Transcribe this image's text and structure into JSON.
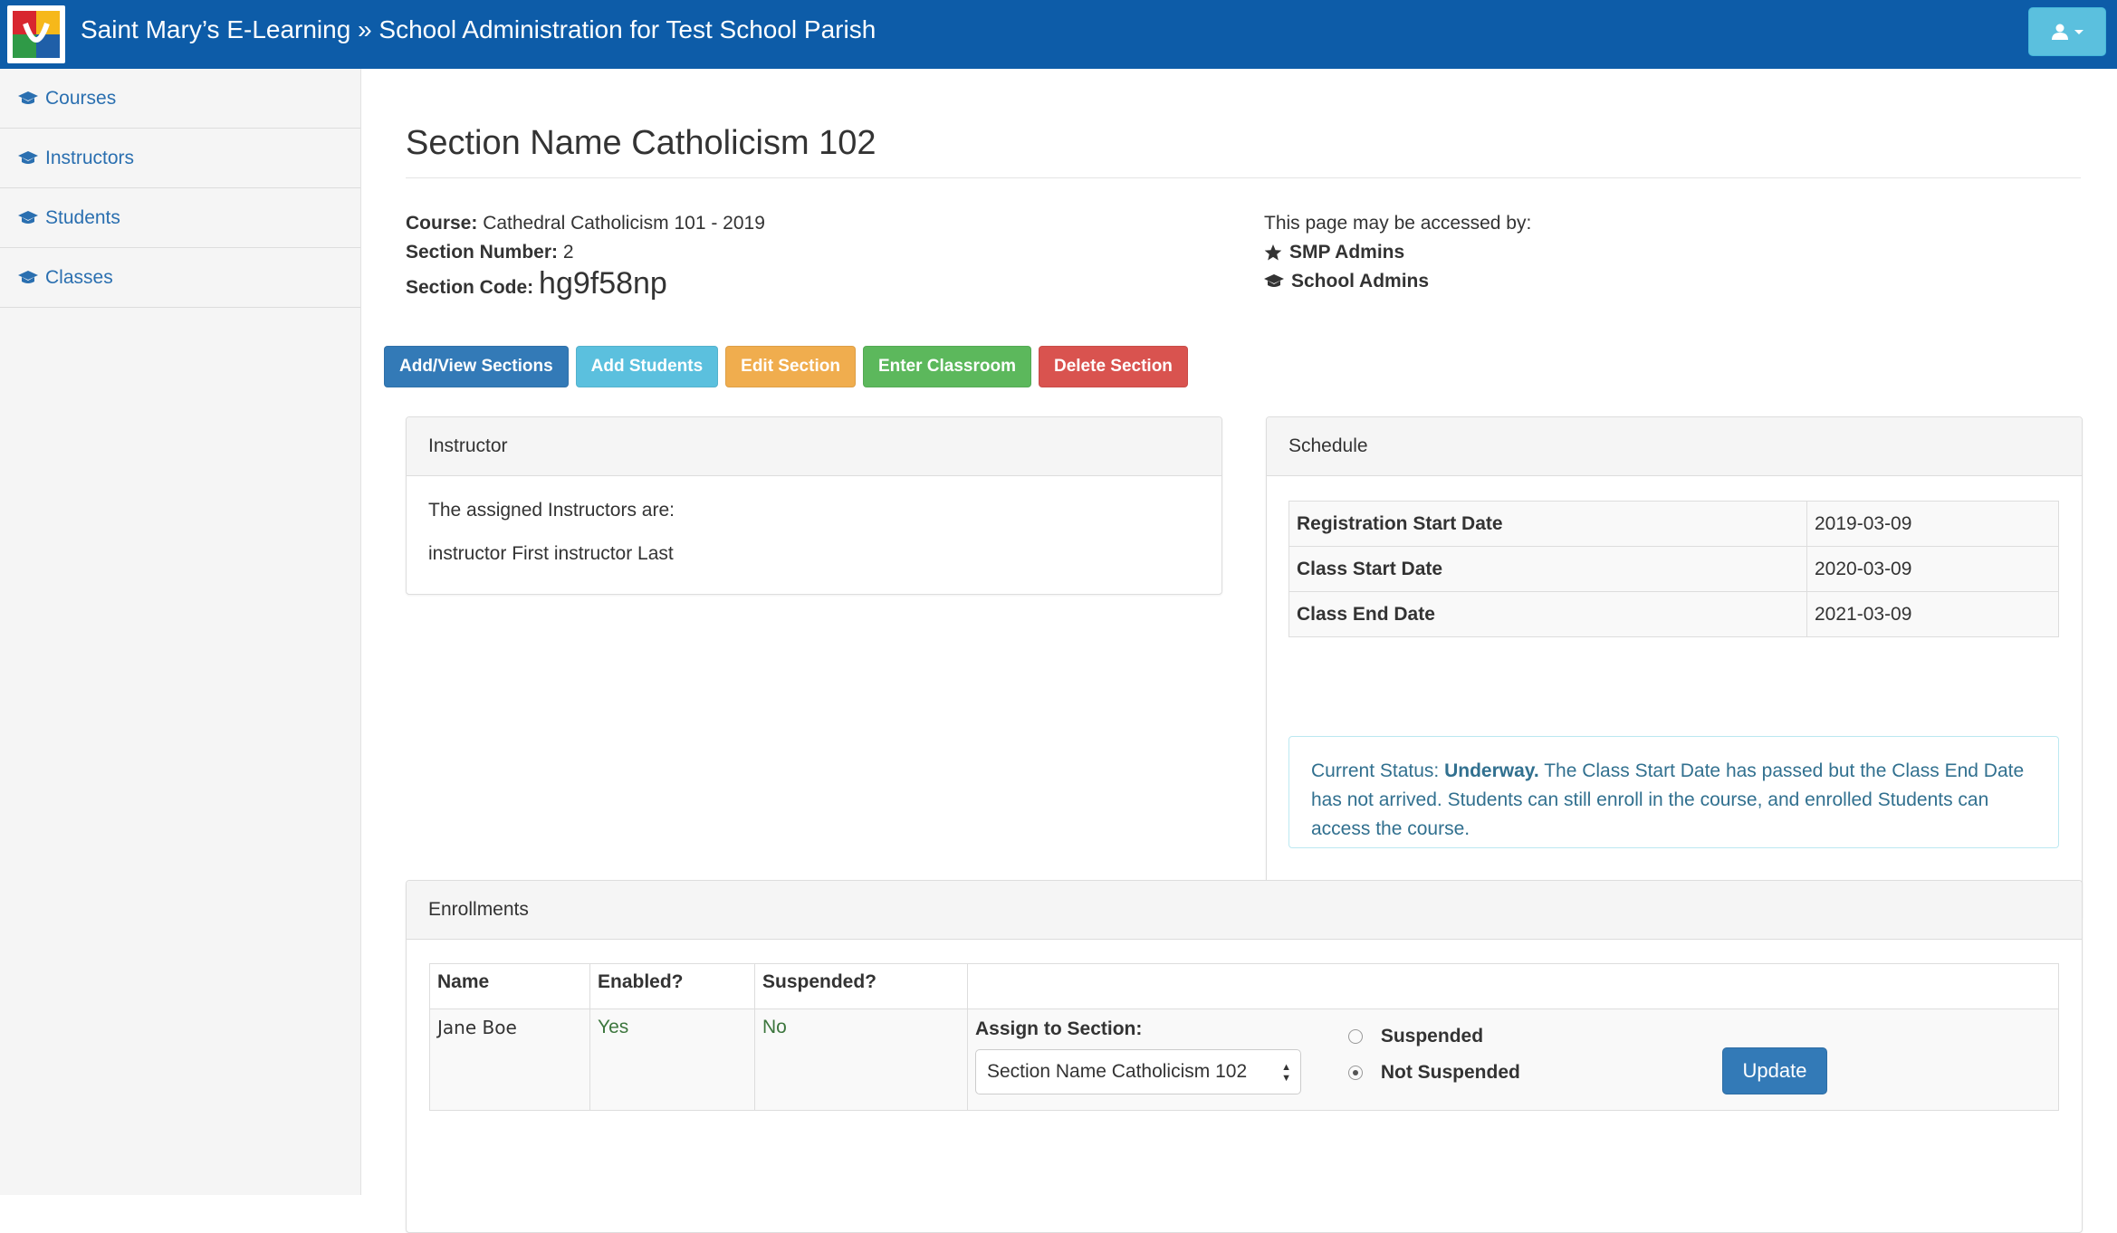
{
  "header": {
    "title": "Saint Mary’s E-Learning » School Administration for Test School Parish",
    "user_icon": "user-icon",
    "colors": {
      "navbar": "#0d5ca8",
      "user_button": "#5bc0de"
    }
  },
  "sidebar": {
    "items": [
      {
        "label": "Courses",
        "icon": "graduation-cap-icon"
      },
      {
        "label": "Instructors",
        "icon": "graduation-cap-icon"
      },
      {
        "label": "Students",
        "icon": "graduation-cap-icon"
      },
      {
        "label": "Classes",
        "icon": "graduation-cap-icon"
      }
    ]
  },
  "page": {
    "title": "Section Name Catholicism 102",
    "course_label": "Course:",
    "course_value": "Cathedral Catholicism 101 - 2019",
    "section_number_label": "Section Number:",
    "section_number_value": "2",
    "section_code_label": "Section Code:",
    "section_code_value": "hg9f58np"
  },
  "access": {
    "intro": "This page may be accessed by:",
    "roles": [
      {
        "label": "SMP Admins",
        "icon": "star-icon"
      },
      {
        "label": "School Admins",
        "icon": "graduation-cap-icon"
      }
    ]
  },
  "actions": {
    "add_view_sections": "Add/View Sections",
    "add_students": "Add Students",
    "edit_section": "Edit Section",
    "enter_classroom": "Enter Classroom",
    "delete_section": "Delete Section",
    "colors": {
      "primary": "#337ab7",
      "info": "#5bc0de",
      "warning": "#f0ad4e",
      "success": "#5cb85c",
      "danger": "#d9534f"
    }
  },
  "instructor_panel": {
    "heading": "Instructor",
    "intro": "The assigned Instructors are:",
    "instructors": [
      "instructor First instructor Last"
    ]
  },
  "schedule_panel": {
    "heading": "Schedule",
    "rows": [
      {
        "label": "Registration Start Date",
        "value": "2019-03-09"
      },
      {
        "label": "Class Start Date",
        "value": "2020-03-09"
      },
      {
        "label": "Class End Date",
        "value": "2021-03-09"
      }
    ],
    "status_prefix": "Current Status:",
    "status_value": "Underway.",
    "status_text": "The Class Start Date has passed but the Class End Date has not arrived. Students can still enroll in the course, and enrolled Students can access the course."
  },
  "enrollments_panel": {
    "heading": "Enrollments",
    "columns": [
      "Name",
      "Enabled?",
      "Suspended?",
      ""
    ],
    "rows": [
      {
        "name": "Jane Boe",
        "enabled": "Yes",
        "suspended": "No",
        "assign_label": "Assign to Section:",
        "assign_value": "Section Name Catholicism 102",
        "option_suspended": "Suspended",
        "option_not_suspended": "Not Suspended",
        "selected_option": "Not Suspended",
        "update_label": "Update"
      }
    ]
  }
}
